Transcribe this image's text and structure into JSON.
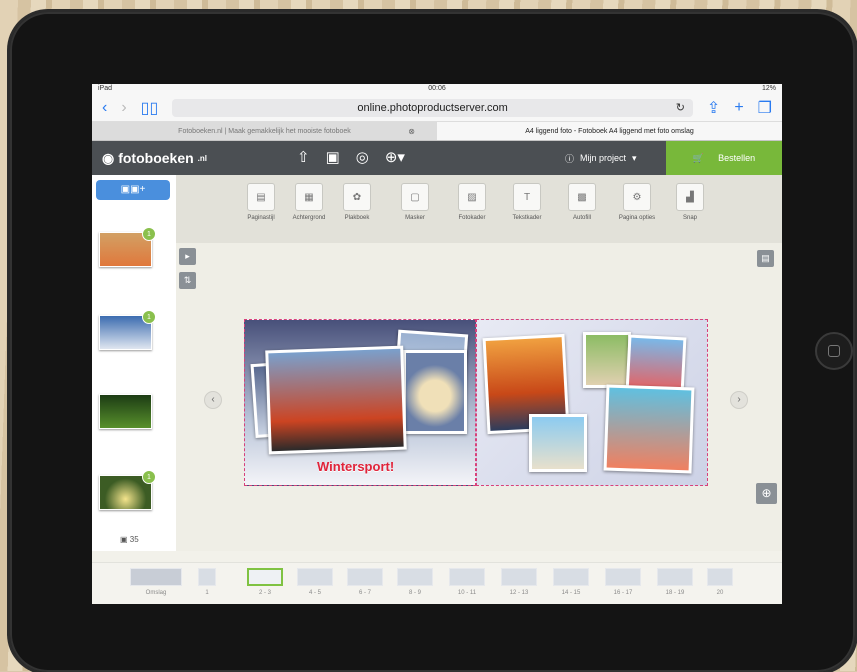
{
  "status": {
    "device": "iPad",
    "time": "00:06",
    "battery": "12%"
  },
  "browser": {
    "url": "online.photoproductserver.com",
    "tabs": [
      {
        "title": "Fotoboeken.nl | Maak gemakkelijk het mooiste fotoboek"
      },
      {
        "title": "A4 liggend foto - Fotoboek A4 liggend met foto omslag"
      }
    ]
  },
  "app": {
    "logo": "fotoboeken",
    "logo_suffix": ".nl",
    "project_label": "Mijn project",
    "order_label": "Bestellen",
    "accent_color": "#78b83a",
    "brand_color": "#4b4f53"
  },
  "sidebar": {
    "photos": [
      {
        "badge": "1"
      },
      {
        "badge": "1"
      },
      {
        "badge": ""
      },
      {
        "badge": "1"
      }
    ],
    "photo_count": "35"
  },
  "toolbar": {
    "tools": [
      "Paginastijl",
      "Achtergrond",
      "Plakboek",
      "Masker",
      "Fotokader",
      "Tekstkader",
      "Autofill",
      "Pagina opties",
      "Snap"
    ]
  },
  "canvas": {
    "caption": "Wintersport!"
  },
  "pages": [
    "Omslag",
    "1",
    "2 - 3",
    "4 - 5",
    "6 - 7",
    "8 - 9",
    "10 - 11",
    "12 - 13",
    "14 - 15",
    "16 - 17",
    "18 - 19",
    "20"
  ]
}
